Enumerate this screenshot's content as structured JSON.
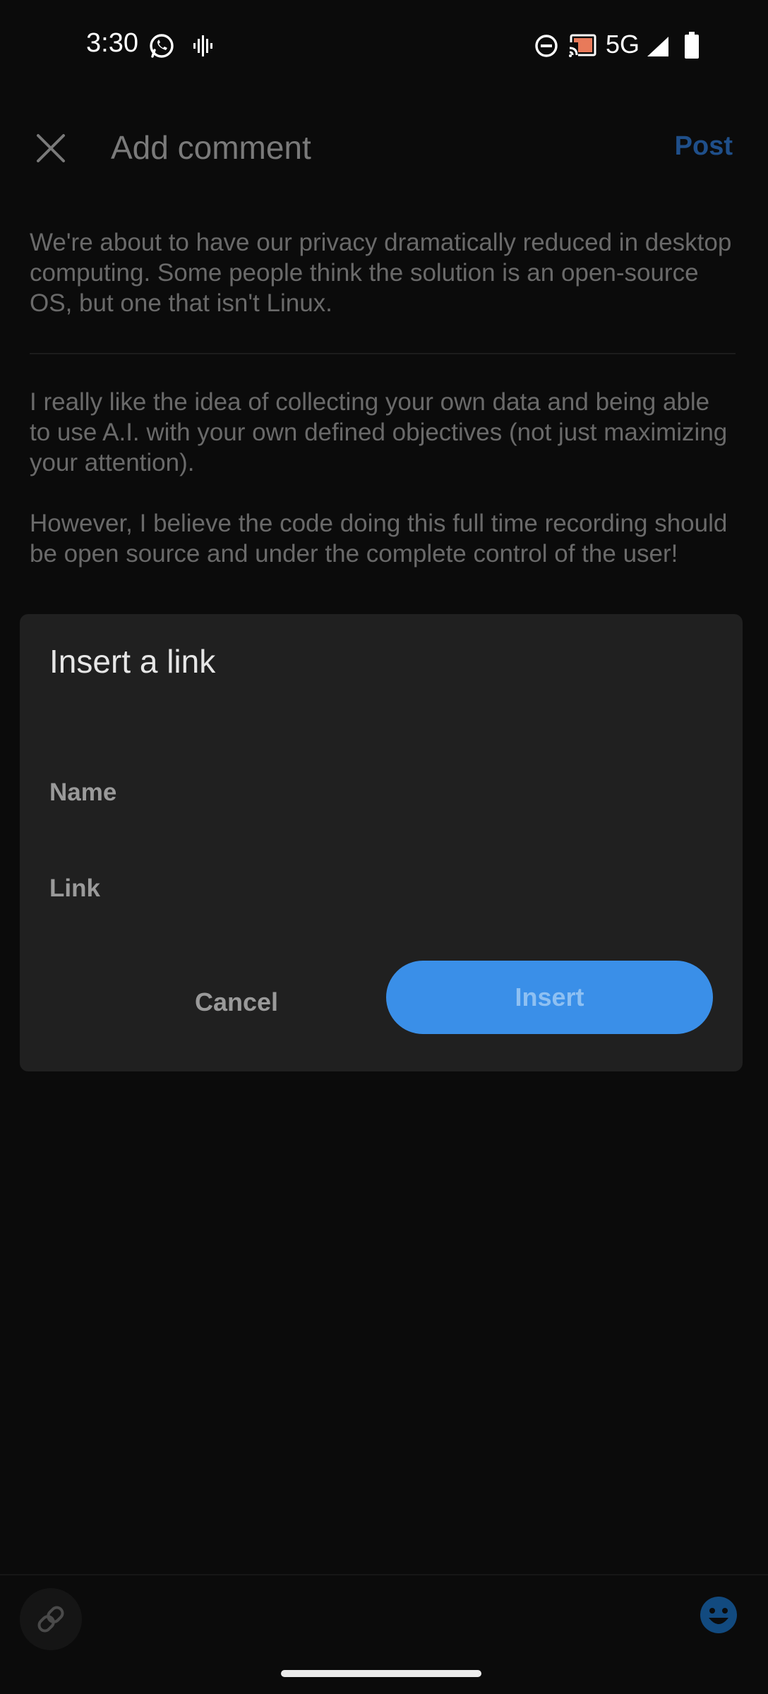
{
  "status_bar": {
    "time": "3:30",
    "network": "5G",
    "icons": [
      "whatsapp-icon",
      "voice-recorder-icon",
      "do-not-disturb-icon",
      "cast-icon",
      "signal-icon",
      "battery-icon"
    ]
  },
  "header": {
    "title": "Add comment",
    "post_label": "Post",
    "close_icon": "close-icon"
  },
  "content": {
    "quote": "We're about to have our privacy dramatically reduced in desktop computing. Some people think the solution is an open-source OS, but one that isn't Linux.",
    "comment_paragraphs": [
      "I really like the idea of collecting your own data and being able to use A.I. with your own defined objectives (not just maximizing your attention).",
      "However, I believe the code doing this full time recording should be open source and under the complete control of the user!"
    ]
  },
  "dialog": {
    "title": "Insert a link",
    "name_placeholder": "Name",
    "link_placeholder": "Link",
    "cancel_label": "Cancel",
    "insert_label": "Insert"
  },
  "toolbar": {
    "icons": [
      "link-icon",
      "emoji-icon"
    ]
  },
  "colors": {
    "accent": "#3a8fe8",
    "dialog_bg": "#202020",
    "background": "#0b0b0b"
  }
}
